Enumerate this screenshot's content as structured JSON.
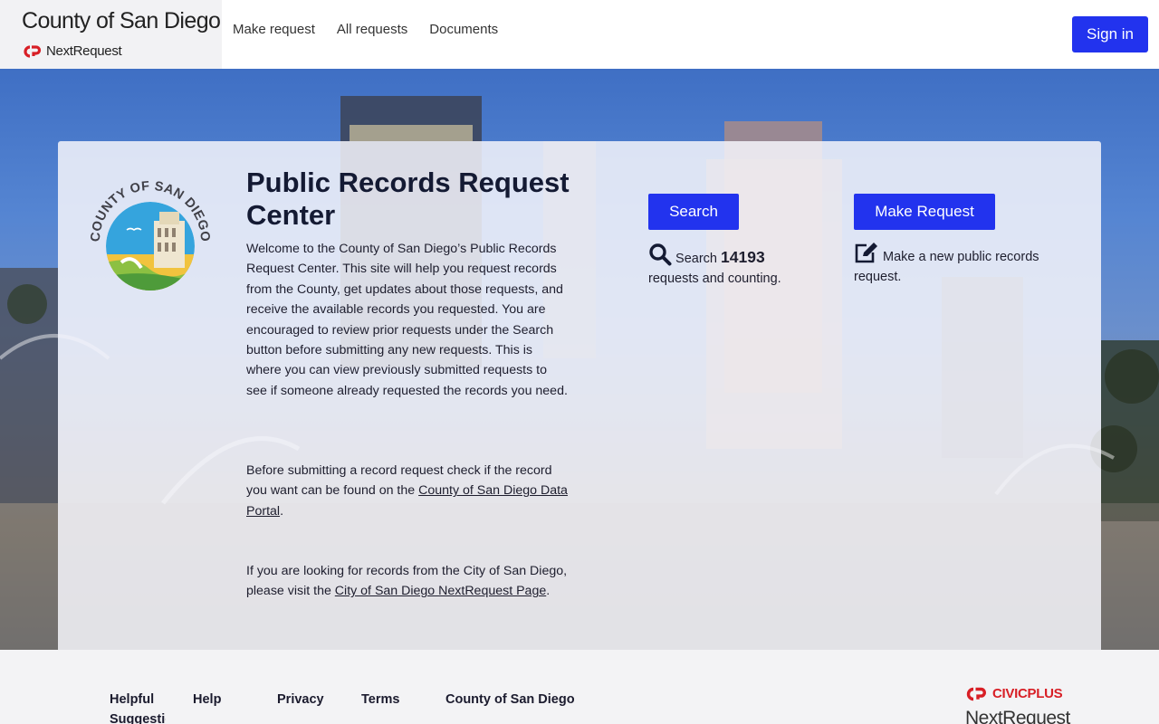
{
  "header": {
    "brand_title": "County of San Diego",
    "brand_sub": "NextRequest",
    "nav": [
      "Make request",
      "All requests",
      "Documents"
    ],
    "sign_in": "Sign in"
  },
  "hero": {
    "logo": {
      "arc_text": "COUNTY OF SAN DIEGO"
    },
    "title": "Public Records Request Center",
    "intro": "Welcome to the County of San Diego’s Public Records Request Center. This site will help you request records from the County, get updates about those requests, and receive the available records you requested. You are encouraged to review prior requests under the Search button before submitting any new requests. This is where you can view previously submitted requests to see if someone already requested the records you need.",
    "para2_before": "Before submitting a record request check if the record you want can be found on the ",
    "para2_link": "County of San Diego Data Portal",
    "para2_after": ".",
    "para3_before": "If you are looking for records from the City of San Diego, please visit the ",
    "para3_link": "City of San Diego NextRequest Page",
    "para3_after": ".",
    "search_button": "Search",
    "search_prefix": "Search",
    "search_count": "14193",
    "search_suffix": "requests and counting.",
    "make_button": "Make Request",
    "make_text": "Make a new public records request."
  },
  "footer": {
    "links": [
      "Helpful Suggestions",
      "Help",
      "Privacy",
      "Terms",
      "County of San Diego"
    ],
    "civic": "CIVICPLUS",
    "nextrequest": "NextRequest"
  },
  "colors": {
    "primary": "#2233ee",
    "civic_red": "#d81f26",
    "title": "#141a33"
  },
  "icons": [
    "nextrequest-logo-icon",
    "search-icon",
    "edit-icon",
    "civicplus-logo-icon"
  ]
}
